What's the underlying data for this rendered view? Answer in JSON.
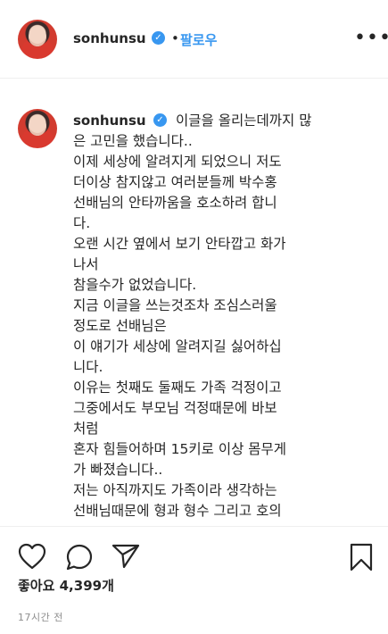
{
  "header": {
    "username": "sonhunsu",
    "separator": "•",
    "follow_label": "팔로우",
    "more_label": "•••"
  },
  "post": {
    "username": "sonhunsu",
    "caption_lines": [
      "이글을 올리는데까지 많",
      "은 고민을 했습니다..",
      "이제 세상에 알려지게 되었으니 저도",
      "더이상 참지않고 여러분들께 박수홍",
      "선배님의 안타까움을 호소하려 합니",
      "다.",
      "오랜 시간 옆에서 보기 안타깝고 화가",
      "나서",
      "참을수가 없었습니다.",
      "지금 이글을 쓰는것조차 조심스러울",
      "정도로 선배님은",
      "이 얘기가 세상에 알려지길 싫어하십",
      "니다.",
      "이유는 첫째도 둘째도 가족 걱정이고",
      "그중에서도 부모님 걱정때문에 바보",
      "처럼",
      "혼자 힘들어하며 15키로 이상 몸무게",
      "가 빠졌습니다..",
      "저는 아직까지도 가족이라 생각하는",
      "선배님때문에 형과 형수 그리고 호의"
    ]
  },
  "actions": {
    "like_icon": "heart-icon",
    "comment_icon": "comment-icon",
    "share_icon": "share-icon",
    "save_icon": "bookmark-icon",
    "likes_text": "좋아요 4,399개",
    "timestamp": "17시간 전"
  },
  "colors": {
    "link_blue": "#3897f0",
    "text": "#262626",
    "muted": "#8e8e8e"
  }
}
